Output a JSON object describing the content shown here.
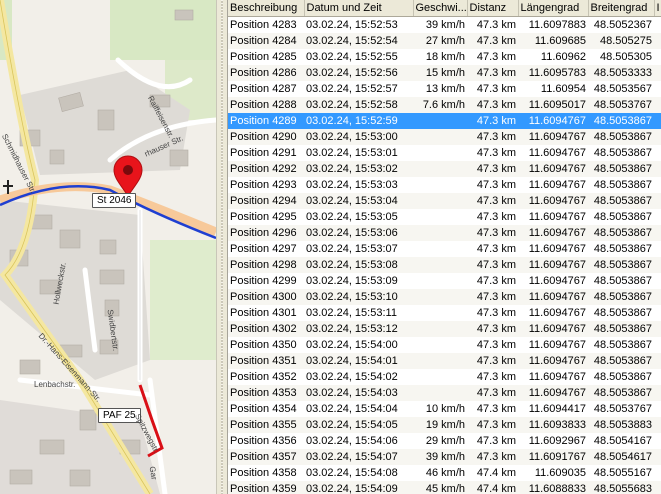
{
  "map": {
    "road_shield_1": "St 2046",
    "road_shield_2": "PAF 25",
    "street_labels": {
      "raiffeisen": "Raiffeisenstr.",
      "schmidhauser": "Schmidhauser Str.",
      "hauser": "rhauser Str.",
      "hollweck": "Hollweckstr.",
      "swidbert": "Swidbertstr.",
      "hans_eisen": "Dr.-Hans-Eisenmann-Str.",
      "lenbach": "Lenbachstr.",
      "spitzweg": "Spitzwegstr.",
      "gar": "Gar"
    },
    "colors": {
      "track": "#1f3fd1",
      "highlight": "#d90f16",
      "marker": "#e8141b",
      "main_road": "#f7c99a"
    }
  },
  "table": {
    "columns": [
      "Beschreibung",
      "Datum und Zeit",
      "Geschwi...",
      "Distanz",
      "Längengrad",
      "Breitengrad",
      "I"
    ],
    "selected_index": 6,
    "rows": [
      [
        "Position 4283",
        "03.02.24, 15:52:53",
        "39 km/h",
        "47.3 km",
        "11.6097883",
        "48.5052367"
      ],
      [
        "Position 4284",
        "03.02.24, 15:52:54",
        "27 km/h",
        "47.3 km",
        "11.609685",
        "48.505275"
      ],
      [
        "Position 4285",
        "03.02.24, 15:52:55",
        "18 km/h",
        "47.3 km",
        "11.60962",
        "48.505305"
      ],
      [
        "Position 4286",
        "03.02.24, 15:52:56",
        "15 km/h",
        "47.3 km",
        "11.6095783",
        "48.5053333"
      ],
      [
        "Position 4287",
        "03.02.24, 15:52:57",
        "13 km/h",
        "47.3 km",
        "11.60954",
        "48.5053567"
      ],
      [
        "Position 4288",
        "03.02.24, 15:52:58",
        "7.6 km/h",
        "47.3 km",
        "11.6095017",
        "48.5053767"
      ],
      [
        "Position 4289",
        "03.02.24, 15:52:59",
        "",
        "47.3 km",
        "11.6094767",
        "48.5053867"
      ],
      [
        "Position 4290",
        "03.02.24, 15:53:00",
        "",
        "47.3 km",
        "11.6094767",
        "48.5053867"
      ],
      [
        "Position 4291",
        "03.02.24, 15:53:01",
        "",
        "47.3 km",
        "11.6094767",
        "48.5053867"
      ],
      [
        "Position 4292",
        "03.02.24, 15:53:02",
        "",
        "47.3 km",
        "11.6094767",
        "48.5053867"
      ],
      [
        "Position 4293",
        "03.02.24, 15:53:03",
        "",
        "47.3 km",
        "11.6094767",
        "48.5053867"
      ],
      [
        "Position 4294",
        "03.02.24, 15:53:04",
        "",
        "47.3 km",
        "11.6094767",
        "48.5053867"
      ],
      [
        "Position 4295",
        "03.02.24, 15:53:05",
        "",
        "47.3 km",
        "11.6094767",
        "48.5053867"
      ],
      [
        "Position 4296",
        "03.02.24, 15:53:06",
        "",
        "47.3 km",
        "11.6094767",
        "48.5053867"
      ],
      [
        "Position 4297",
        "03.02.24, 15:53:07",
        "",
        "47.3 km",
        "11.6094767",
        "48.5053867"
      ],
      [
        "Position 4298",
        "03.02.24, 15:53:08",
        "",
        "47.3 km",
        "11.6094767",
        "48.5053867"
      ],
      [
        "Position 4299",
        "03.02.24, 15:53:09",
        "",
        "47.3 km",
        "11.6094767",
        "48.5053867"
      ],
      [
        "Position 4300",
        "03.02.24, 15:53:10",
        "",
        "47.3 km",
        "11.6094767",
        "48.5053867"
      ],
      [
        "Position 4301",
        "03.02.24, 15:53:11",
        "",
        "47.3 km",
        "11.6094767",
        "48.5053867"
      ],
      [
        "Position 4302",
        "03.02.24, 15:53:12",
        "",
        "47.3 km",
        "11.6094767",
        "48.5053867"
      ],
      [
        "Position 4350",
        "03.02.24, 15:54:00",
        "",
        "47.3 km",
        "11.6094767",
        "48.5053867"
      ],
      [
        "Position 4351",
        "03.02.24, 15:54:01",
        "",
        "47.3 km",
        "11.6094767",
        "48.5053867"
      ],
      [
        "Position 4352",
        "03.02.24, 15:54:02",
        "",
        "47.3 km",
        "11.6094767",
        "48.5053867"
      ],
      [
        "Position 4353",
        "03.02.24, 15:54:03",
        "",
        "47.3 km",
        "11.6094767",
        "48.5053867"
      ],
      [
        "Position 4354",
        "03.02.24, 15:54:04",
        "10 km/h",
        "47.3 km",
        "11.6094417",
        "48.5053767"
      ],
      [
        "Position 4355",
        "03.02.24, 15:54:05",
        "19 km/h",
        "47.3 km",
        "11.6093833",
        "48.5053883"
      ],
      [
        "Position 4356",
        "03.02.24, 15:54:06",
        "29 km/h",
        "47.3 km",
        "11.6092967",
        "48.5054167"
      ],
      [
        "Position 4357",
        "03.02.24, 15:54:07",
        "39 km/h",
        "47.3 km",
        "11.6091767",
        "48.5054617"
      ],
      [
        "Position 4358",
        "03.02.24, 15:54:08",
        "46 km/h",
        "47.4 km",
        "11.609035",
        "48.5055167"
      ],
      [
        "Position 4359",
        "03.02.24, 15:54:09",
        "45 km/h",
        "47.4 km",
        "11.6088833",
        "48.5055683"
      ]
    ]
  }
}
